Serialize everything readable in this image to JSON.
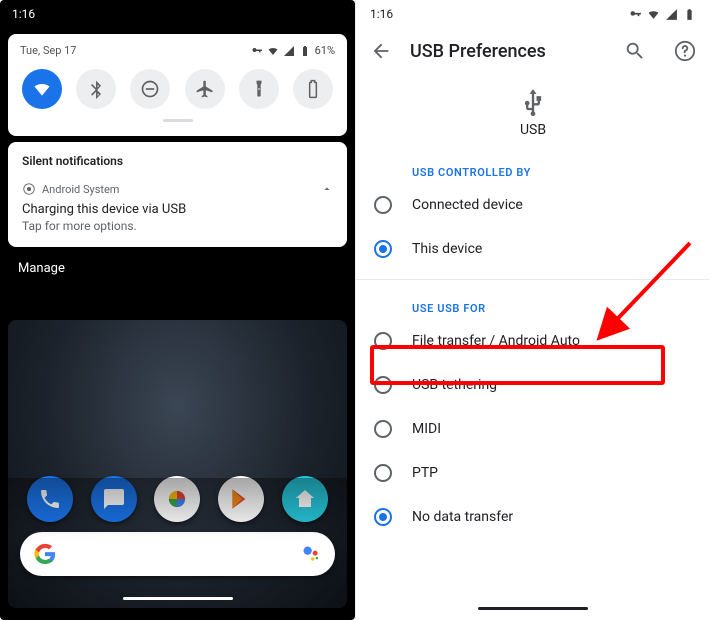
{
  "left": {
    "time": "1:16",
    "date": "Tue, Sep 17",
    "battery": "61%",
    "toggles": [
      "wifi",
      "bluetooth",
      "dnd",
      "airplane",
      "flashlight",
      "battery"
    ],
    "silent_header": "Silent notifications",
    "sys_label": "Android System",
    "notif_title": "Charging this device via USB",
    "notif_sub": "Tap for more options.",
    "manage": "Manage"
  },
  "right": {
    "time": "1:16",
    "title": "USB Preferences",
    "hero": "USB",
    "section1": "USB CONTROLLED BY",
    "opt_connected": "Connected device",
    "opt_this": "This device",
    "section2": "USE USB FOR",
    "opt_file": "File transfer / Android Auto",
    "opt_tether": "USB tethering",
    "opt_midi": "MIDI",
    "opt_ptp": "PTP",
    "opt_nodata": "No data transfer"
  }
}
